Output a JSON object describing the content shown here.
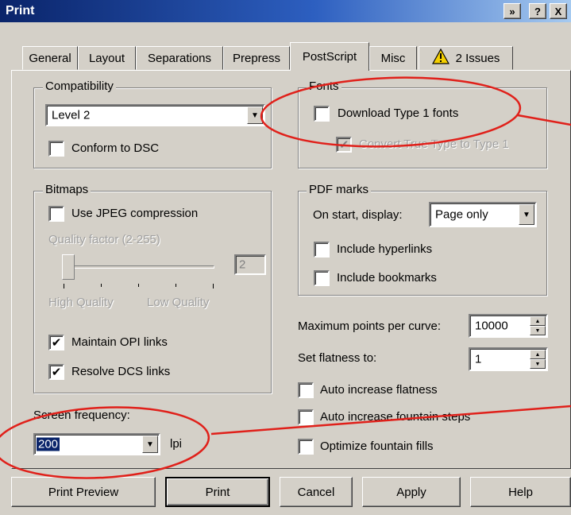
{
  "window": {
    "title": "Print",
    "buttons": [
      "»",
      "?",
      "X"
    ]
  },
  "tabs": [
    "General",
    "Layout",
    "Separations",
    "Prepress",
    "PostScript",
    "Misc",
    "2 Issues"
  ],
  "compatibility": {
    "legend": "Compatibility",
    "level": "Level 2",
    "conform_dsc": "Conform to DSC"
  },
  "fonts": {
    "legend": "Fonts",
    "download_type1": "Download Type 1 fonts",
    "convert_truetype": "Convert True Type to Type 1"
  },
  "bitmaps": {
    "legend": "Bitmaps",
    "use_jpeg": "Use JPEG compression",
    "quality_factor": "Quality factor (2-255)",
    "quality_value": "2",
    "high_quality": "High Quality",
    "low_quality": "Low Quality",
    "maintain_opi": "Maintain OPI links",
    "resolve_dcs": "Resolve DCS links"
  },
  "pdf_marks": {
    "legend": "PDF marks",
    "on_start_label": "On start, display:",
    "on_start_value": "Page only",
    "include_hyperlinks": "Include hyperlinks",
    "include_bookmarks": "Include bookmarks"
  },
  "curve": {
    "max_points_label": "Maximum points per curve:",
    "max_points_value": "10000",
    "flatness_label": "Set flatness to:",
    "flatness_value": "1",
    "auto_flatness": "Auto increase flatness",
    "auto_fountain": "Auto increase fountain steps",
    "optimize_fountain": "Optimize fountain fills"
  },
  "screen": {
    "label": "Screen frequency:",
    "value": "200",
    "unit": "lpi"
  },
  "buttons": {
    "print_preview": "Print Preview",
    "print": "Print",
    "cancel": "Cancel",
    "apply": "Apply",
    "help": "Help"
  },
  "colors": {
    "annotation": "#e0201a",
    "titlebar": "#0a246a",
    "warning": "#f5d000"
  }
}
